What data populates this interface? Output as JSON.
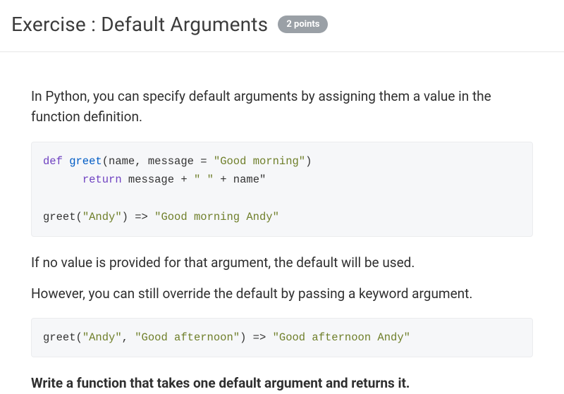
{
  "header": {
    "title": "Exercise : Default Arguments",
    "points_badge": "2 points"
  },
  "content": {
    "intro": "In Python, you can specify default arguments by assigning them a value in the function definition.",
    "code1": {
      "l1_kw": "def",
      "l1_fn": " greet",
      "l1_paren_open": "(",
      "l1_args": "name, message ",
      "l1_eq": "=",
      "l1_sp": " ",
      "l1_str": "\"Good morning\"",
      "l1_close": ")",
      "l2_indent": "      ",
      "l2_kw": "return",
      "l2_rest_a": " message ",
      "l2_plus1": "+",
      "l2_sp1": " ",
      "l2_str_space": "\" \"",
      "l2_sp2": " ",
      "l2_plus2": "+",
      "l2_rest_b": " name\"",
      "l3_blank": "",
      "l4_pre": "greet(",
      "l4_str": "\"Andy\"",
      "l4_mid": ") ",
      "l4_arrow": "=>",
      "l4_sp": " ",
      "l4_res": "\"Good morning Andy\""
    },
    "para_default": "If no value is provided for that argument, the default will be used.",
    "para_override": "However, you can still override the default by passing a keyword argument.",
    "code2": {
      "pre": "greet(",
      "arg1": "\"Andy\"",
      "comma": ", ",
      "arg2": "\"Good afternoon\"",
      "mid": ") ",
      "arrow": "=>",
      "sp": " ",
      "res": "\"Good afternoon Andy\""
    },
    "instruction": "Write a function that takes one default argument and returns it."
  }
}
